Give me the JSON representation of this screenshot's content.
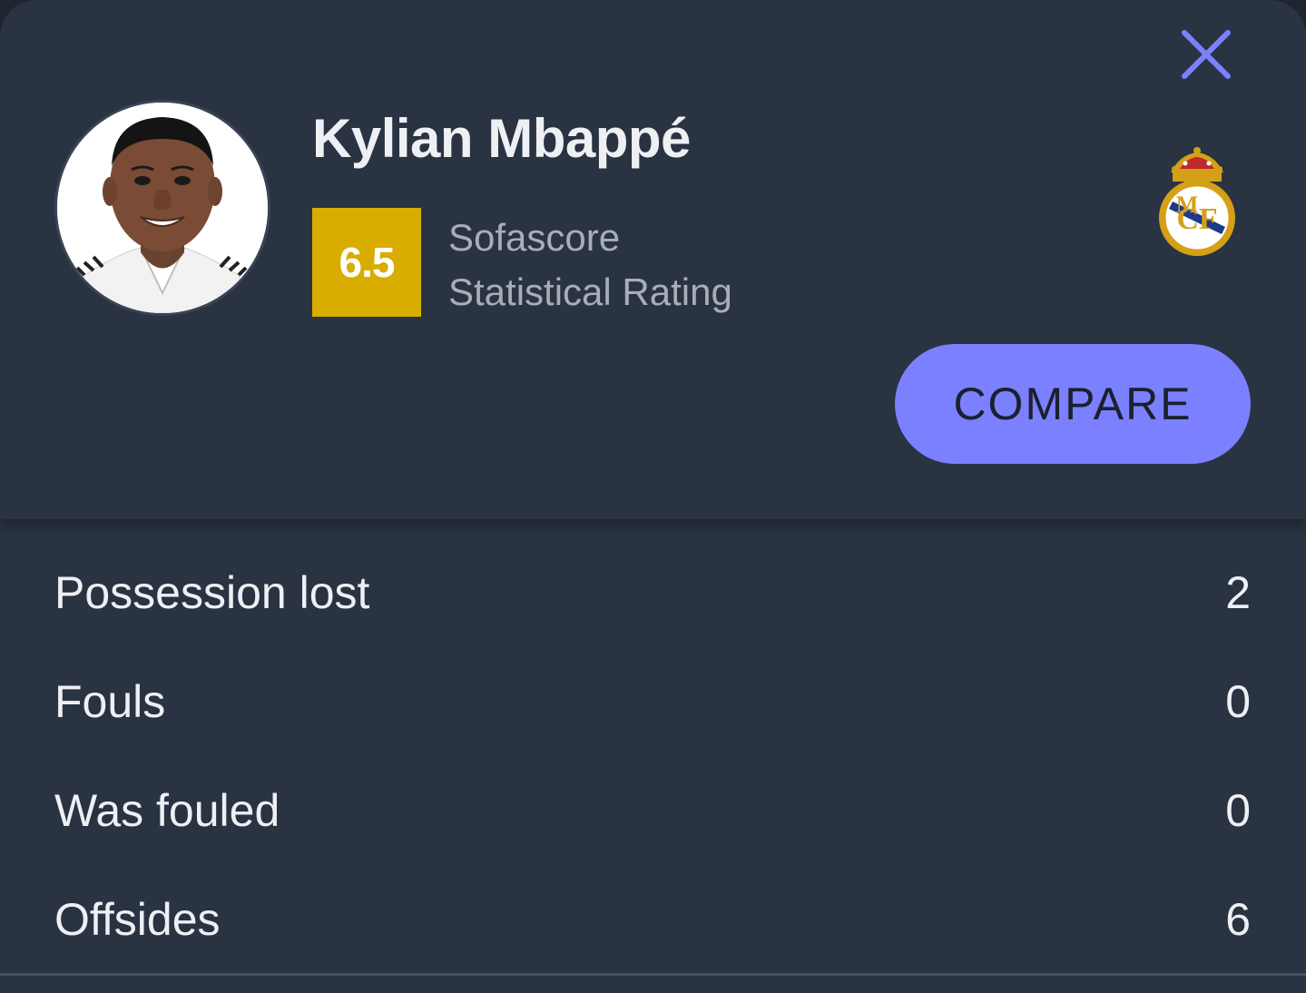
{
  "player": {
    "name": "Kylian Mbappé",
    "avatar_icon": "player-photo",
    "club_icon": "real-madrid-crest-icon"
  },
  "rating": {
    "value": "6.5",
    "label_line1": "Sofascore",
    "label_line2": "Statistical Rating",
    "color": "#d9ad00"
  },
  "actions": {
    "close_icon": "close-icon",
    "compare_label": "COMPARE",
    "accent_color": "#7b80ff"
  },
  "stats": [
    {
      "label": "Possession lost",
      "value": "2"
    },
    {
      "label": "Fouls",
      "value": "0"
    },
    {
      "label": "Was fouled",
      "value": "0"
    },
    {
      "label": "Offsides",
      "value": "6"
    }
  ]
}
